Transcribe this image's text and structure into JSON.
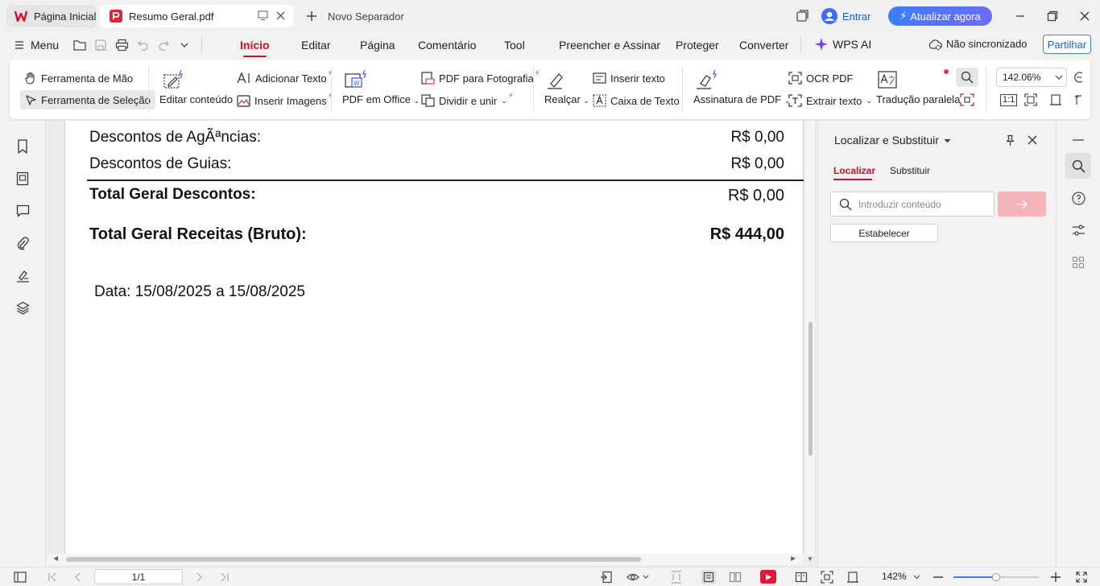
{
  "tabs": {
    "home_label": "Página Inicial",
    "doc_label": "Resumo Geral.pdf",
    "new_label": "Novo Separador"
  },
  "account": {
    "signin_label": "Entrar",
    "upgrade_label": "Atualizar agora"
  },
  "menu": {
    "menu_label": "Menu",
    "tabs": [
      "Início",
      "Editar",
      "Página",
      "Comentário",
      "Tool",
      "Preencher e Assinar",
      "Proteger",
      "Converter",
      "WPS AI"
    ],
    "active_tab": "Início",
    "sync_label": "Não sincronizado",
    "share_label": "Partilhar"
  },
  "ribbon": {
    "hand_tool": "Ferramenta de Mão",
    "select_tool": "Ferramenta de Seleção",
    "edit_content": "Editar conteúdo",
    "add_text": "Adicionar Texto",
    "insert_images": "Inserir Imagens",
    "pdf_to_office": "PDF em Office",
    "pdf_to_photo": "PDF para Fotografia",
    "split_merge": "Dividir e unir",
    "highlight": "Realçar",
    "insert_text": "Inserir texto",
    "text_box": "Caixa de Texto",
    "pdf_signature": "Assinatura de PDF",
    "ocr_pdf": "OCR PDF",
    "extract_text": "Extrair texto",
    "parallel_translation": "Tradução paralela",
    "zoom_value": "142.06%",
    "actual_size_label": "1:1"
  },
  "document": {
    "rows": [
      {
        "label": "Descontos de AgÃªncias:",
        "value": "R$ 0,00"
      },
      {
        "label": "Descontos de Guias:",
        "value": "R$ 0,00"
      }
    ],
    "total_discounts_label": "Total Geral Descontos:",
    "total_discounts_value": "R$ 0,00",
    "total_revenue_label": "Total Geral Receitas (Bruto):",
    "total_revenue_value": "R$ 444,00",
    "date_line": "Data: 15/08/2025 a 15/08/2025"
  },
  "find_panel": {
    "title": "Localizar e Substituir",
    "tab_find": "Localizar",
    "tab_replace": "Substituir",
    "search_placeholder": "Introduzir conteúdo",
    "establish_label": "Estabelecer"
  },
  "status": {
    "page_indicator": "1/1",
    "zoom_label": "142%",
    "zoom_slider_fraction": 0.5
  },
  "colors": {
    "accent_red": "#c8102e",
    "brand_blue": "#3d7cff",
    "go_button_disabled": "#f5b5b8"
  }
}
